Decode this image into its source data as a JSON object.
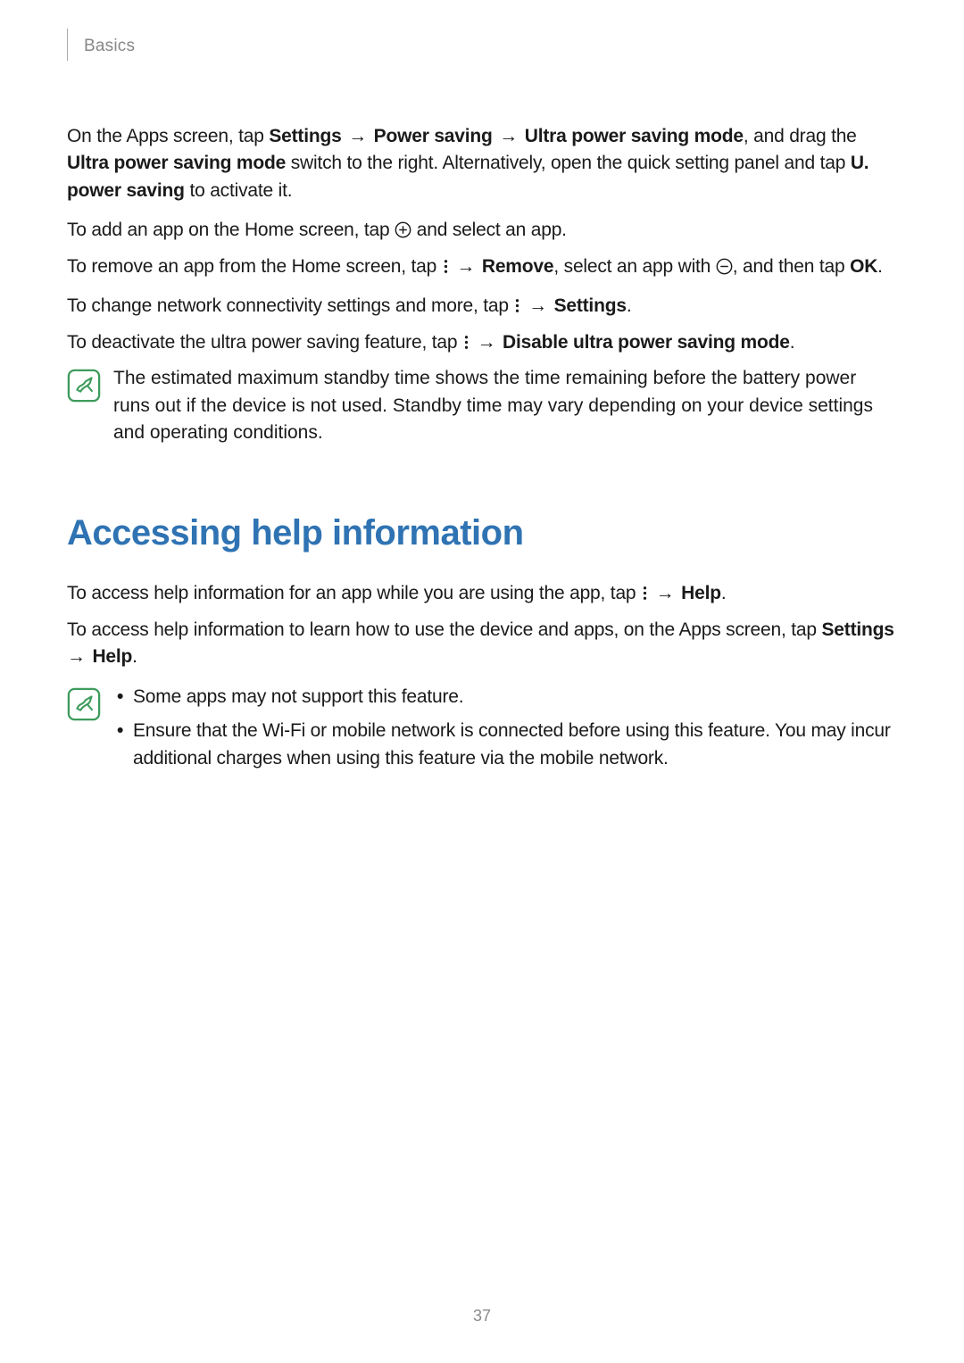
{
  "header": {
    "breadcrumb": "Basics"
  },
  "para1": {
    "pre": "On the Apps screen, tap ",
    "s1": "Settings",
    "a1": " → ",
    "s2": "Power saving",
    "a2": " → ",
    "s3": "Ultra power saving mode",
    "mid": ", and drag the ",
    "s4": "Ultra power saving mode",
    "post1": " switch to the right. Alternatively, open the quick setting panel and tap ",
    "s5": "U. power saving",
    "post2": " to activate it."
  },
  "para2": {
    "pre": "To add an app on the Home screen, tap ",
    "post": " and select an app."
  },
  "para3": {
    "pre": "To remove an app from the Home screen, tap ",
    "a1": " → ",
    "s1": "Remove",
    "mid": ", select an app with ",
    "post1": ", and then tap ",
    "s2": "OK",
    "post2": "."
  },
  "para4": {
    "pre": "To change network connectivity settings and more, tap ",
    "a1": " → ",
    "s1": "Settings",
    "post": "."
  },
  "para5": {
    "pre": "To deactivate the ultra power saving feature, tap ",
    "a1": " → ",
    "s1": "Disable ultra power saving mode",
    "post": "."
  },
  "note1": {
    "text": "The estimated maximum standby time shows the time remaining before the battery power runs out if the device is not used. Standby time may vary depending on your device settings and operating conditions."
  },
  "section2": {
    "title": "Accessing help information"
  },
  "para6": {
    "pre": "To access help information for an app while you are using the app, tap ",
    "a1": " → ",
    "s1": "Help",
    "post": "."
  },
  "para7": {
    "pre": "To access help information to learn how to use the device and apps, on the Apps screen, tap ",
    "s1": "Settings",
    "a1": " → ",
    "s2": "Help",
    "post": "."
  },
  "note2": {
    "item1": "Some apps may not support this feature.",
    "item2": "Ensure that the Wi-Fi or mobile network is connected before using this feature. You may incur additional charges when using this feature via the mobile network."
  },
  "page_number": "37"
}
